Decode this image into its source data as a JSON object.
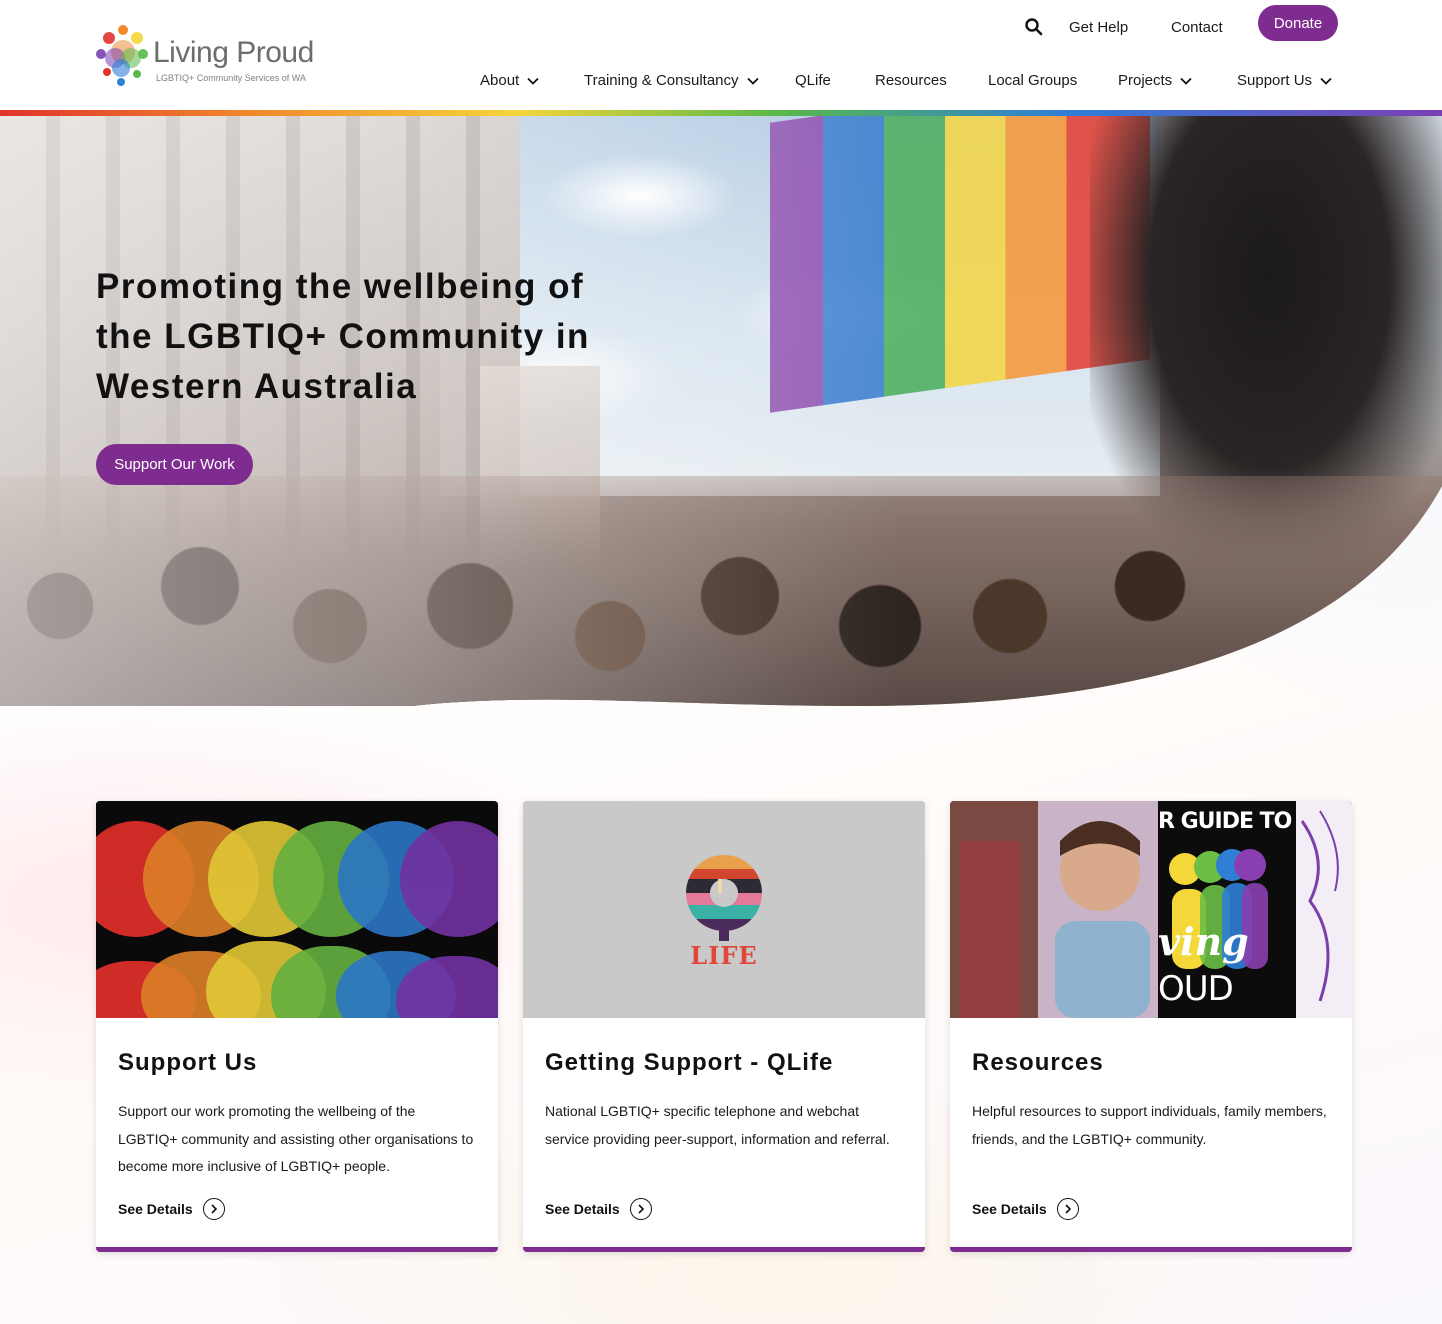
{
  "header": {
    "logo": {
      "name": "Living Proud",
      "tagline": "LGBTIQ+ Community Services of WA",
      "dot_colors": [
        "#e1332d",
        "#f18b2c",
        "#f4d53a",
        "#58b948",
        "#2f7ed8",
        "#7b3fb4"
      ]
    },
    "util_links": {
      "search_icon": "search-icon",
      "get_help": "Get Help",
      "contact": "Contact",
      "donate": "Donate"
    },
    "nav": [
      {
        "label": "About",
        "has_dropdown": true
      },
      {
        "label": "Training & Consultancy",
        "has_dropdown": true
      },
      {
        "label": "QLife",
        "has_dropdown": false
      },
      {
        "label": "Resources",
        "has_dropdown": false
      },
      {
        "label": "Local Groups",
        "has_dropdown": false
      },
      {
        "label": "Projects",
        "has_dropdown": true
      },
      {
        "label": "Support Us",
        "has_dropdown": true
      }
    ]
  },
  "hero": {
    "title_line1": "Promoting the wellbeing of",
    "title_line2_pre": "the ",
    "title_line2_bold": "LGBTIQ+ Community",
    "title_line2_post": " in",
    "title_line3": "Western Australia",
    "button": "Support Our Work"
  },
  "cards": [
    {
      "title": "Support Us",
      "description": "Support our work promoting the wellbeing of the LGBTIQ+ community and assisting other organisations to become more inclusive of LGBTIQ+ people.",
      "link": "See Details"
    },
    {
      "title": "Getting Support - QLife",
      "description": "National LGBTIQ+ specific telephone and webchat service providing peer-support, information and referral.",
      "link": "See Details",
      "image_text": "LIFE"
    },
    {
      "title": "Resources",
      "description": "Helpful resources to support individuals, family members, friends, and the LGBTIQ+ community.",
      "link": "See Details",
      "image_text_top": "R GUIDE TO",
      "image_text_script": "ving",
      "image_text_bottom": "OUD"
    }
  ],
  "colors": {
    "brand_purple": "#7f2c91",
    "text": "#111111"
  }
}
